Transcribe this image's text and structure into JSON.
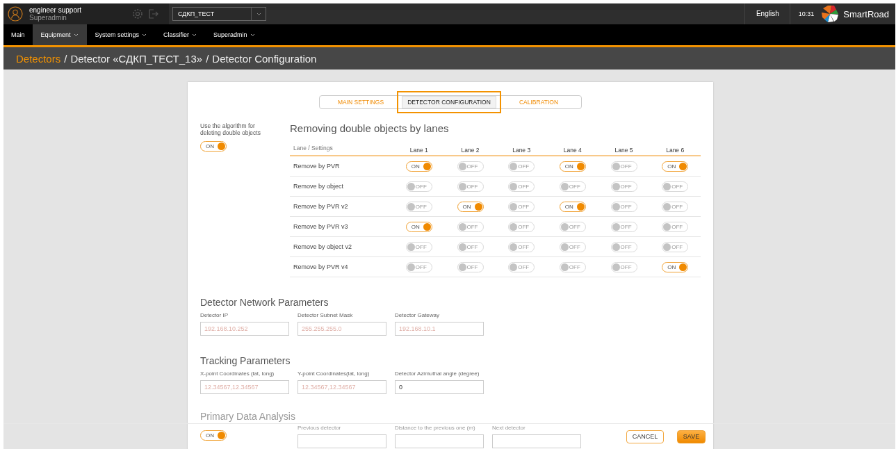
{
  "header": {
    "user_name": "engineer support",
    "user_role": "Superadmin",
    "project_select": {
      "value": "СДКП_ТЕСТ"
    },
    "language": "English",
    "time": "10:31",
    "brand": "SmartRoad"
  },
  "nav": [
    {
      "label": "Main",
      "selected": false,
      "has_menu": false
    },
    {
      "label": "Equipment",
      "selected": true,
      "has_menu": true
    },
    {
      "label": "System settings",
      "selected": false,
      "has_menu": true
    },
    {
      "label": "Classifier",
      "selected": false,
      "has_menu": true
    },
    {
      "label": "Superadmin",
      "selected": false,
      "has_menu": true
    }
  ],
  "breadcrumb": {
    "separator": "/",
    "items": [
      {
        "label": "Detectors",
        "link": true
      },
      {
        "label": "Detector «СДКП_ТЕСТ_13»",
        "link": false
      },
      {
        "label": "Detector Configuration",
        "link": false
      }
    ]
  },
  "tabs": [
    {
      "label": "MAIN SETTINGS",
      "selected": false
    },
    {
      "label": "DETECTOR CONFIGURATION",
      "selected": true
    },
    {
      "label": "CALIBRATION",
      "selected": false
    }
  ],
  "dedup": {
    "description": "Use the algorithm for deleting double objects",
    "toggle": {
      "on": true,
      "label": "ON"
    },
    "title": "Removing double objects by lanes",
    "corner_header": "Lane / Settings",
    "lanes": [
      "Lane 1",
      "Lane 2",
      "Lane 3",
      "Lane 4",
      "Lane 5",
      "Lane 6"
    ],
    "rows": [
      {
        "name": "Remove by PVR",
        "toggles": [
          {
            "on": true,
            "label": "ON"
          },
          {
            "on": false,
            "label": "OFF"
          },
          {
            "on": false,
            "label": "OFF"
          },
          {
            "on": true,
            "label": "ON"
          },
          {
            "on": false,
            "label": "OFF"
          },
          {
            "on": true,
            "label": "ON"
          }
        ]
      },
      {
        "name": "Remove by object",
        "toggles": [
          {
            "on": false,
            "label": "OFF"
          },
          {
            "on": false,
            "label": "OFF"
          },
          {
            "on": false,
            "label": "OFF"
          },
          {
            "on": false,
            "label": "OFF"
          },
          {
            "on": false,
            "label": "OFF"
          },
          {
            "on": false,
            "label": "OFF"
          }
        ]
      },
      {
        "name": "Remove by PVR v2",
        "toggles": [
          {
            "on": false,
            "label": "OFF"
          },
          {
            "on": true,
            "label": "ON"
          },
          {
            "on": false,
            "label": "OFF"
          },
          {
            "on": true,
            "label": "ON"
          },
          {
            "on": false,
            "label": "OFF"
          },
          {
            "on": false,
            "label": "OFF"
          }
        ]
      },
      {
        "name": "Remove by PVR v3",
        "toggles": [
          {
            "on": true,
            "label": "ON"
          },
          {
            "on": false,
            "label": "OFF"
          },
          {
            "on": false,
            "label": "OFF"
          },
          {
            "on": false,
            "label": "OFF"
          },
          {
            "on": false,
            "label": "OFF"
          },
          {
            "on": false,
            "label": "OFF"
          }
        ]
      },
      {
        "name": "Remove by object v2",
        "toggles": [
          {
            "on": false,
            "label": "OFF"
          },
          {
            "on": false,
            "label": "OFF"
          },
          {
            "on": false,
            "label": "OFF"
          },
          {
            "on": false,
            "label": "OFF"
          },
          {
            "on": false,
            "label": "OFF"
          },
          {
            "on": false,
            "label": "OFF"
          }
        ]
      },
      {
        "name": "Remove by PVR v4",
        "toggles": [
          {
            "on": false,
            "label": "OFF"
          },
          {
            "on": false,
            "label": "OFF"
          },
          {
            "on": false,
            "label": "OFF"
          },
          {
            "on": false,
            "label": "OFF"
          },
          {
            "on": false,
            "label": "OFF"
          },
          {
            "on": true,
            "label": "ON"
          }
        ]
      }
    ]
  },
  "network": {
    "title": "Detector Network Parameters",
    "fields": [
      {
        "label": "Detector IP",
        "placeholder": "192.168.10.252"
      },
      {
        "label": "Detector Subnet Mask",
        "placeholder": "255.255.255.0"
      },
      {
        "label": "Detector Gateway",
        "placeholder": "192.168.10.1"
      }
    ]
  },
  "tracking": {
    "title": "Tracking Parameters",
    "fields": [
      {
        "label": "X-point Coordinates (lat, long)",
        "placeholder": "12.34567,12.34567"
      },
      {
        "label": "Y-point Coordinates(lat, long)",
        "placeholder": "12.34567,12.34567"
      },
      {
        "label": "Detector Azimuthal angle (degree)",
        "value": "0"
      }
    ]
  },
  "primary": {
    "title": "Primary Data Analysis",
    "toggle": {
      "on": true,
      "label": "ON"
    },
    "fields": [
      {
        "label": "Previous detector"
      },
      {
        "label": "Distance to the previous one (m)"
      },
      {
        "label": "Next detector"
      }
    ]
  },
  "footer_buttons": [
    {
      "label": "CANCEL",
      "kind": "secondary"
    },
    {
      "label": "SAVE",
      "kind": "primary"
    }
  ]
}
